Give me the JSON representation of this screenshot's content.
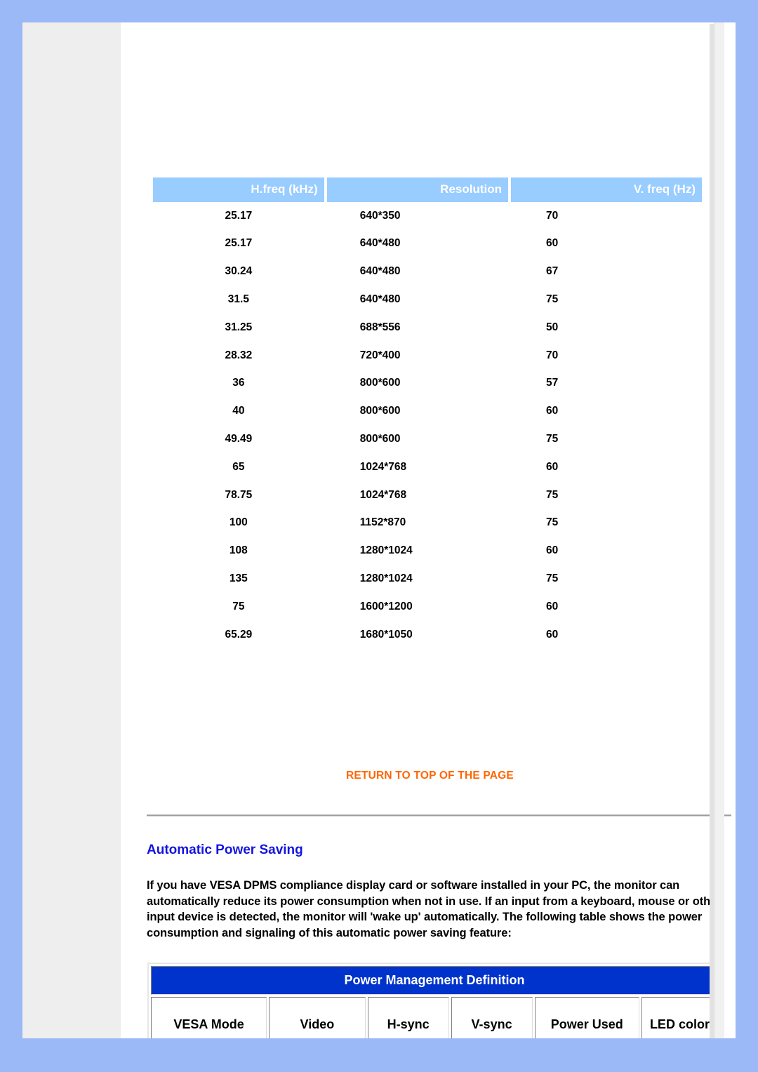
{
  "timing_table": {
    "headers": [
      "H.freq (kHz)",
      "Resolution",
      "V. freq (Hz)"
    ],
    "rows": [
      {
        "hfreq": "25.17",
        "resolution": "640*350",
        "vfreq": "70"
      },
      {
        "hfreq": "25.17",
        "resolution": "640*480",
        "vfreq": "60"
      },
      {
        "hfreq": "30.24",
        "resolution": "640*480",
        "vfreq": "67"
      },
      {
        "hfreq": "31.5",
        "resolution": "640*480",
        "vfreq": "75"
      },
      {
        "hfreq": "31.25",
        "resolution": "688*556",
        "vfreq": "50"
      },
      {
        "hfreq": "28.32",
        "resolution": "720*400",
        "vfreq": "70"
      },
      {
        "hfreq": "36",
        "resolution": "800*600",
        "vfreq": "57"
      },
      {
        "hfreq": "40",
        "resolution": "800*600",
        "vfreq": "60"
      },
      {
        "hfreq": "49.49",
        "resolution": "800*600",
        "vfreq": "75"
      },
      {
        "hfreq": "65",
        "resolution": "1024*768",
        "vfreq": "60"
      },
      {
        "hfreq": "78.75",
        "resolution": "1024*768",
        "vfreq": "75"
      },
      {
        "hfreq": "100",
        "resolution": "1152*870",
        "vfreq": "75"
      },
      {
        "hfreq": "108",
        "resolution": "1280*1024",
        "vfreq": "60"
      },
      {
        "hfreq": "135",
        "resolution": "1280*1024",
        "vfreq": "75"
      },
      {
        "hfreq": "75",
        "resolution": "1600*1200",
        "vfreq": "60"
      },
      {
        "hfreq": "65.29",
        "resolution": "1680*1050",
        "vfreq": "60"
      }
    ]
  },
  "return_link": {
    "label": "RETURN TO TOP OF THE PAGE",
    "color": "#FF6600"
  },
  "section": {
    "heading": "Automatic Power Saving",
    "heading_color": "#1414E0",
    "paragraph": "If you have VESA DPMS compliance display card or software installed in your PC, the monitor can automatically reduce its power consumption when not in use. If an input from a keyboard, mouse or other input device is detected, the monitor will 'wake up' automatically. The following table shows the power consumption and signaling of this automatic power saving feature:"
  },
  "power_management_table": {
    "title": "Power Management Definition",
    "title_bg": "#0033CC",
    "headers": [
      "VESA Mode",
      "Video",
      "H-sync",
      "V-sync",
      "Power Used",
      "LED color"
    ]
  },
  "theme": {
    "page_background": "#9BB8F7",
    "sidebar_background": "#EEEEEE",
    "table_header_blue": "#99CCFF"
  }
}
